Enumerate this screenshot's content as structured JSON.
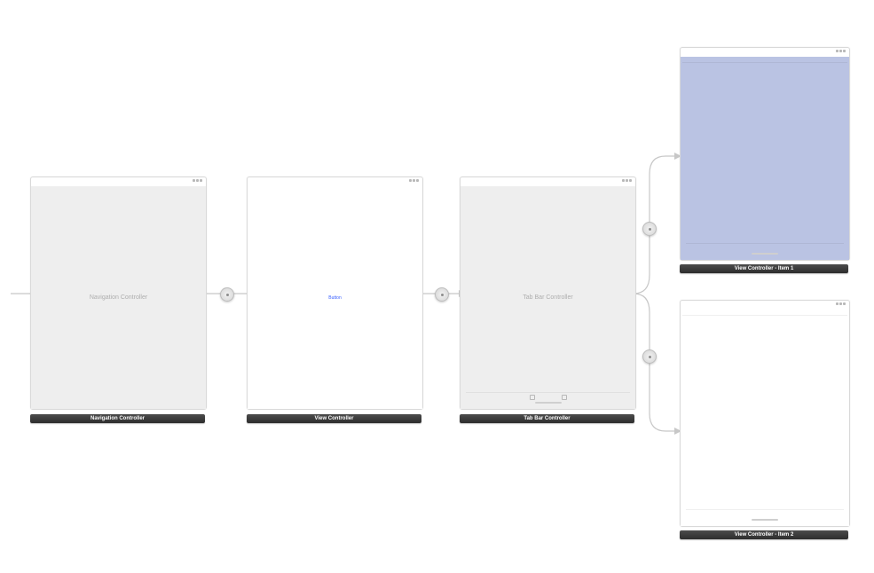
{
  "scenes": {
    "nav": {
      "content_text": "Navigation Controller",
      "label": "Navigation Controller"
    },
    "view": {
      "button_text": "Button",
      "label": "View Controller"
    },
    "tab": {
      "content_text": "Tab Bar Controller",
      "label": "Tab Bar Controller"
    },
    "item1": {
      "label": "View Controller - Item 1"
    },
    "item2": {
      "label": "View Controller - Item 2"
    }
  }
}
